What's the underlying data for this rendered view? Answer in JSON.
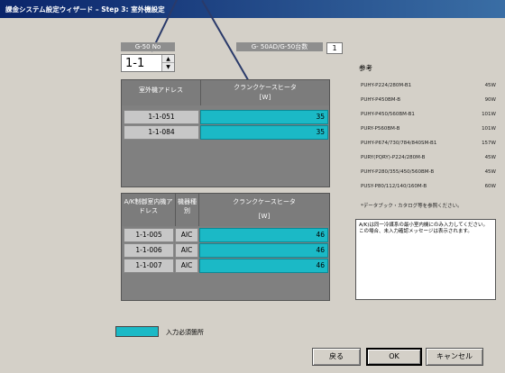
{
  "window": {
    "title": "課金システム設定ウィザード – Step 3: 室外機設定"
  },
  "g50": {
    "label": "G-50 No",
    "value": "1-1"
  },
  "count": {
    "label": "G- 50AD/G-50台数",
    "value": "1"
  },
  "outdoor_table": {
    "headers": [
      "室外機アドレス",
      "クランクケースヒータ",
      "[W]"
    ],
    "rows": [
      {
        "address": "1-1-051",
        "value": "35"
      },
      {
        "address": "1-1-084",
        "value": "35"
      }
    ]
  },
  "indoor_table": {
    "headers": [
      "A/K制御室内機アドレス",
      "機器種別",
      "クランクケースヒータ",
      "[W]"
    ],
    "rows": [
      {
        "address": "1-1-005",
        "type": "AIC",
        "value": "46"
      },
      {
        "address": "1-1-006",
        "type": "AIC",
        "value": "46"
      },
      {
        "address": "1-1-007",
        "type": "AIC",
        "value": "46"
      }
    ]
  },
  "reference": {
    "title": "参考",
    "rows": [
      {
        "model": "PUHY-P224/280M-B1",
        "watt": "45W"
      },
      {
        "model": "PUHY-P450BM-B",
        "watt": "90W"
      },
      {
        "model": "PUHY-P450/560BM-B1",
        "watt": "101W"
      },
      {
        "model": "PURY-P560BM-B",
        "watt": "101W"
      },
      {
        "model": "PUHY-P674/730/784/840SM-B1",
        "watt": "157W"
      },
      {
        "model": "PURY(PQRY)-P224/280M-B",
        "watt": "45W"
      },
      {
        "model": "PUHY-P280/355/450/560BM-B",
        "watt": "45W"
      },
      {
        "model": "PUSY-P80/112/140/160M-B",
        "watt": "60W"
      }
    ],
    "note": "*データブック・カタログ等を参照ください。"
  },
  "info_box": "A/K)は同一冷媒系の最小室内機にのみ入力してください。この場合、未入力確認メッセージは表示されます。",
  "legend": {
    "label": "入力必須箇所"
  },
  "buttons": {
    "back": "戻る",
    "ok": "OK",
    "cancel": "キャンセル"
  },
  "colors": {
    "required": "#1bb9c6",
    "header": "#7c7c7c",
    "titlebar": "#0a246a"
  }
}
